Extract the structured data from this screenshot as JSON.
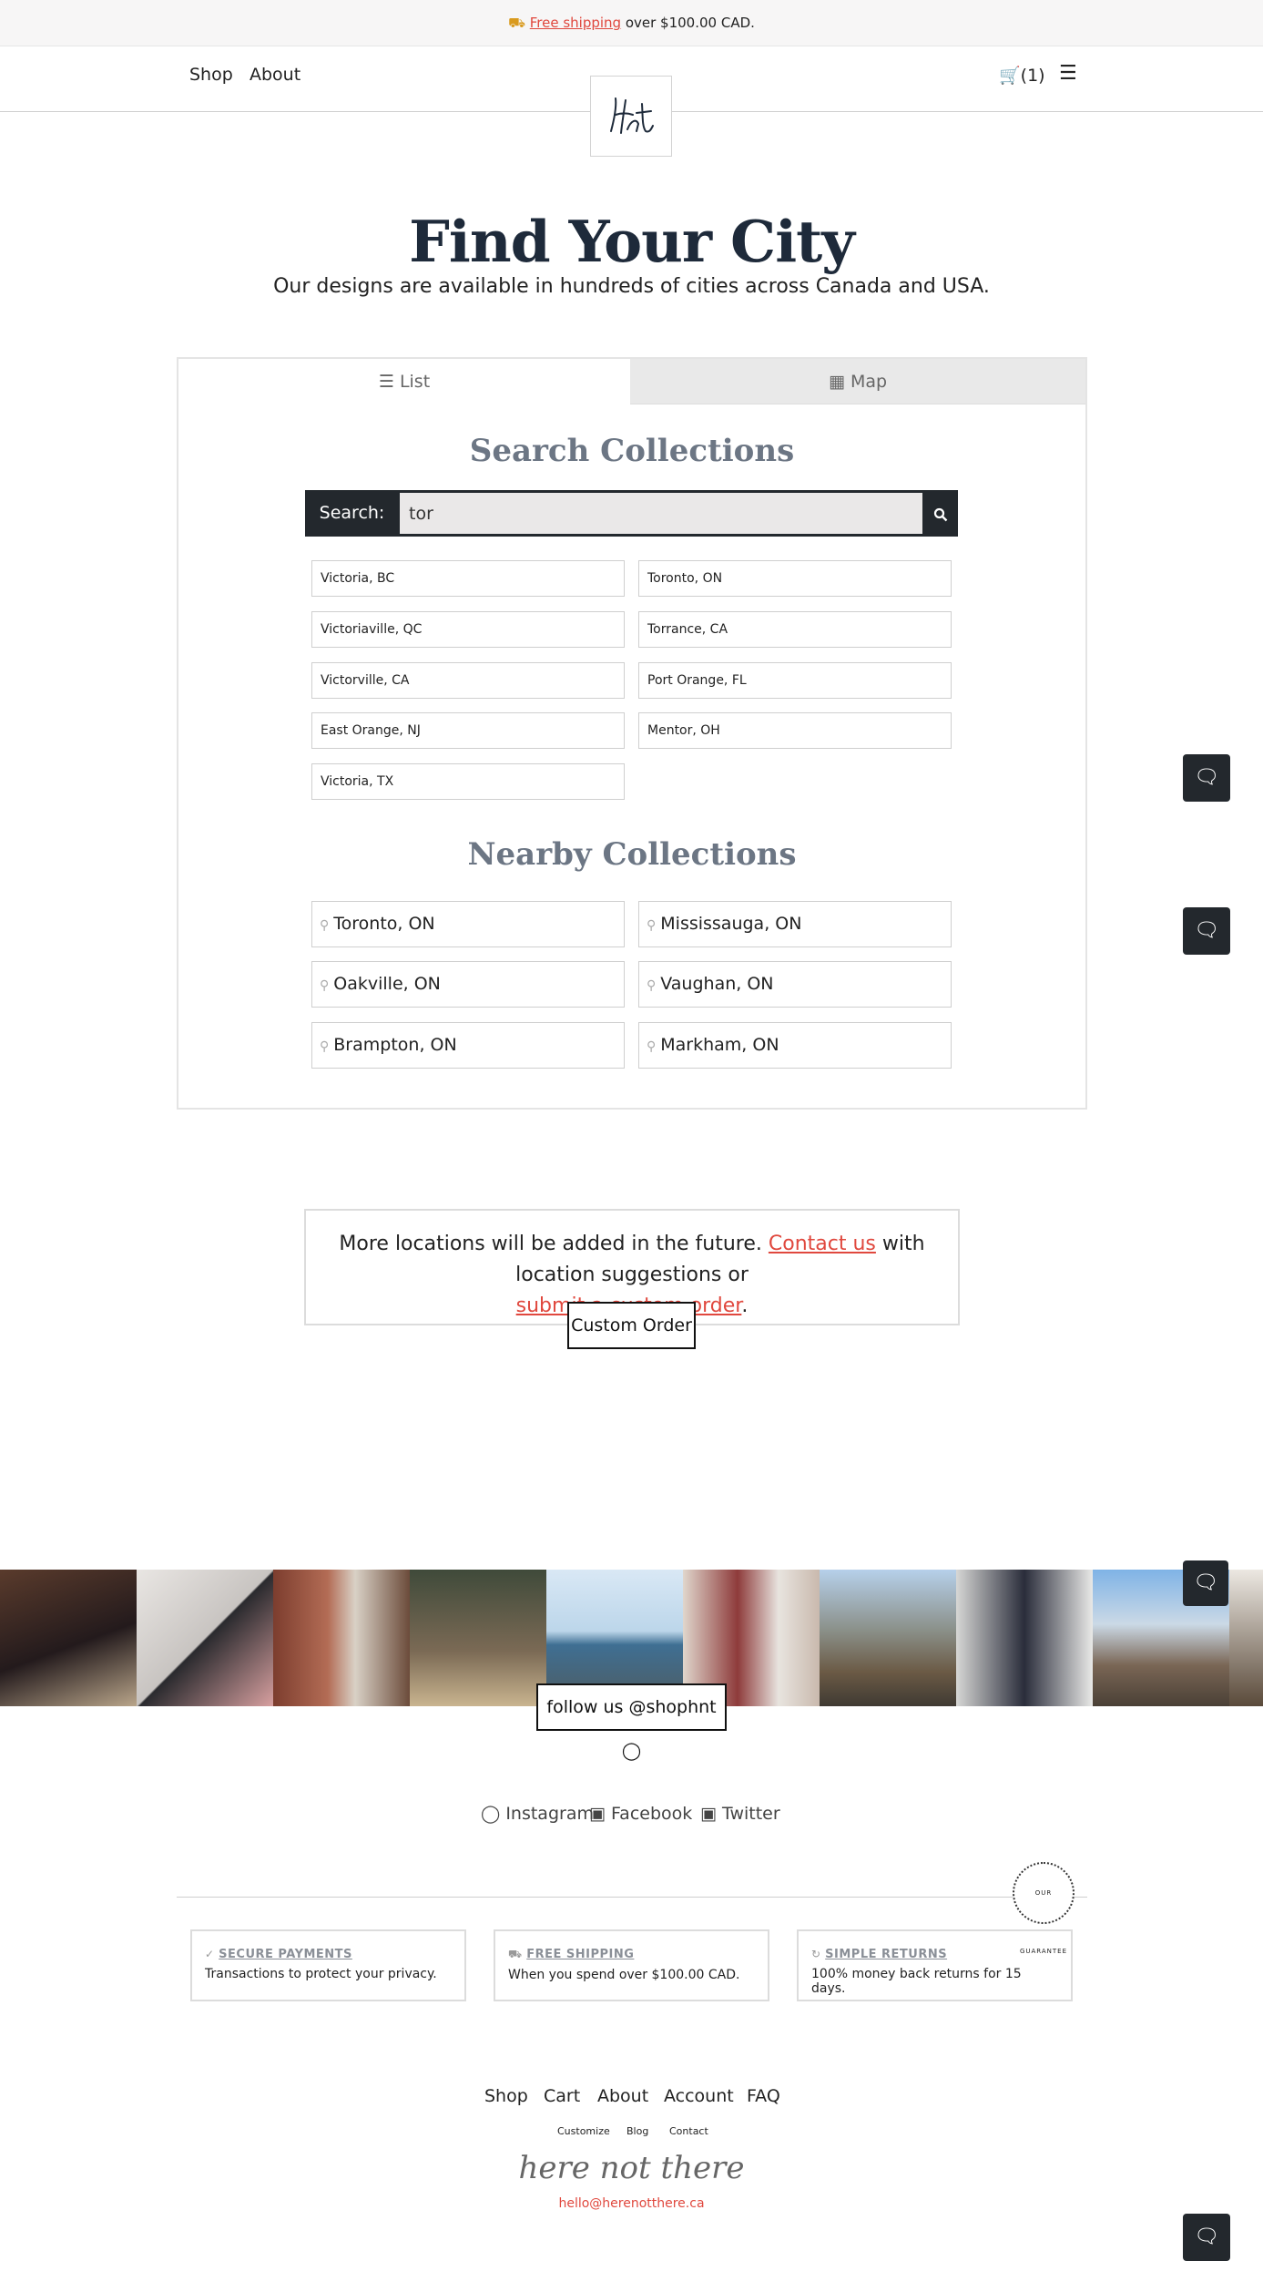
{
  "promo": {
    "icon": "truck-icon",
    "link": "Free shipping",
    "rest": " over $100.00 CAD."
  },
  "nav": {
    "shop": "Shop",
    "about": "About",
    "cart_count": "(1)"
  },
  "hero": {
    "title": "Find Your City",
    "subtitle": "Our designs are available in hundreds of cities across Canada and USA."
  },
  "tabs": {
    "list": "List",
    "map": "Map"
  },
  "search": {
    "heading": "Search Collections",
    "label": "Search:",
    "value": "tor"
  },
  "results": [
    "Victoria, BC",
    "Toronto, ON",
    "Victoriaville, QC",
    "Torrance, CA",
    "Victorville, CA",
    "Port Orange, FL",
    "East Orange, NJ",
    "Mentor, OH",
    "Victoria, TX"
  ],
  "nearby": {
    "heading": "Nearby Collections",
    "items": [
      "Toronto, ON",
      "Mississauga, ON",
      "Oakville, ON",
      "Vaughan, ON",
      "Brampton, ON",
      "Markham, ON"
    ]
  },
  "more": {
    "p1": "More locations will be added in the future. ",
    "contact": "Contact us",
    "p2": " with location suggestions or ",
    "custom": "submit a custom order",
    "p3": ".",
    "button": "Custom Order"
  },
  "instagram": {
    "follow": "follow us @shophnt"
  },
  "social": {
    "instagram": "Instagram",
    "facebook": "Facebook",
    "twitter": "Twitter"
  },
  "guarantee": {
    "badge": "OUR GUARANTEE",
    "items": [
      {
        "title": "SECURE PAYMENTS",
        "desc": "Transactions to protect your privacy."
      },
      {
        "title": "FREE SHIPPING",
        "desc": "When you spend over $100.00 CAD."
      },
      {
        "title": "SIMPLE RETURNS",
        "desc": "100% money back returns for 15 days."
      }
    ]
  },
  "footer": {
    "links": [
      "Shop",
      "Cart",
      "About",
      "Account",
      "FAQ"
    ],
    "small": [
      "Customize",
      "Blog",
      "Contact"
    ],
    "script": "here not there",
    "email": "hello@herenotthere.ca"
  },
  "colors": {
    "accent": "#e0483e",
    "dark": "#23282d",
    "heading": "#1e2a3a"
  }
}
